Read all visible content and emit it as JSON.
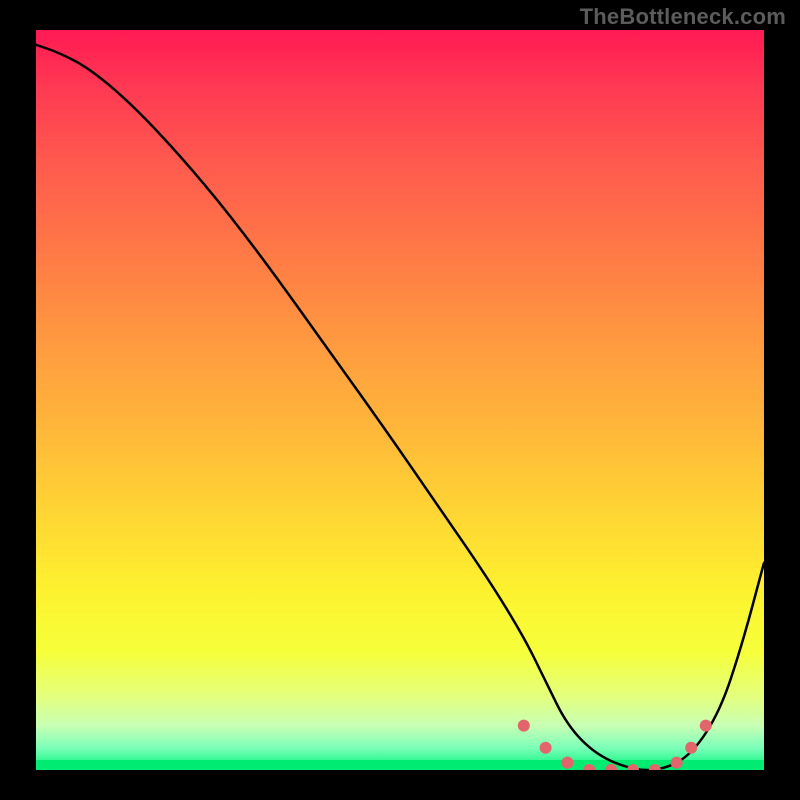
{
  "watermark": "TheBottleneck.com",
  "colors": {
    "frame": "#000000",
    "curve": "#000000",
    "markers": "#e2656b"
  },
  "chart_data": {
    "type": "line",
    "title": "",
    "xlabel": "",
    "ylabel": "",
    "xlim": [
      0,
      100
    ],
    "ylim": [
      0,
      100
    ],
    "series": [
      {
        "name": "curve",
        "x": [
          0,
          3,
          7,
          12,
          18,
          25,
          32,
          40,
          48,
          55,
          62,
          67,
          70,
          73,
          77,
          82,
          86,
          90,
          94,
          97,
          100
        ],
        "y": [
          98,
          97,
          95,
          91,
          85,
          77,
          68,
          57,
          46,
          36,
          26,
          18,
          12,
          6,
          2,
          0,
          0,
          2,
          8,
          17,
          28
        ]
      }
    ],
    "markers": [
      {
        "x": 67,
        "y": 6
      },
      {
        "x": 70,
        "y": 3
      },
      {
        "x": 73,
        "y": 1
      },
      {
        "x": 76,
        "y": 0
      },
      {
        "x": 79,
        "y": 0
      },
      {
        "x": 82,
        "y": 0
      },
      {
        "x": 85,
        "y": 0
      },
      {
        "x": 88,
        "y": 1
      },
      {
        "x": 90,
        "y": 3
      },
      {
        "x": 92,
        "y": 6
      }
    ],
    "gradient_stops": [
      {
        "pos": 0.0,
        "color": "#ff1a53"
      },
      {
        "pos": 0.3,
        "color": "#ff7946"
      },
      {
        "pos": 0.6,
        "color": "#ffcb35"
      },
      {
        "pos": 0.85,
        "color": "#f6ff3a"
      },
      {
        "pos": 1.0,
        "color": "#00eb72"
      }
    ]
  }
}
